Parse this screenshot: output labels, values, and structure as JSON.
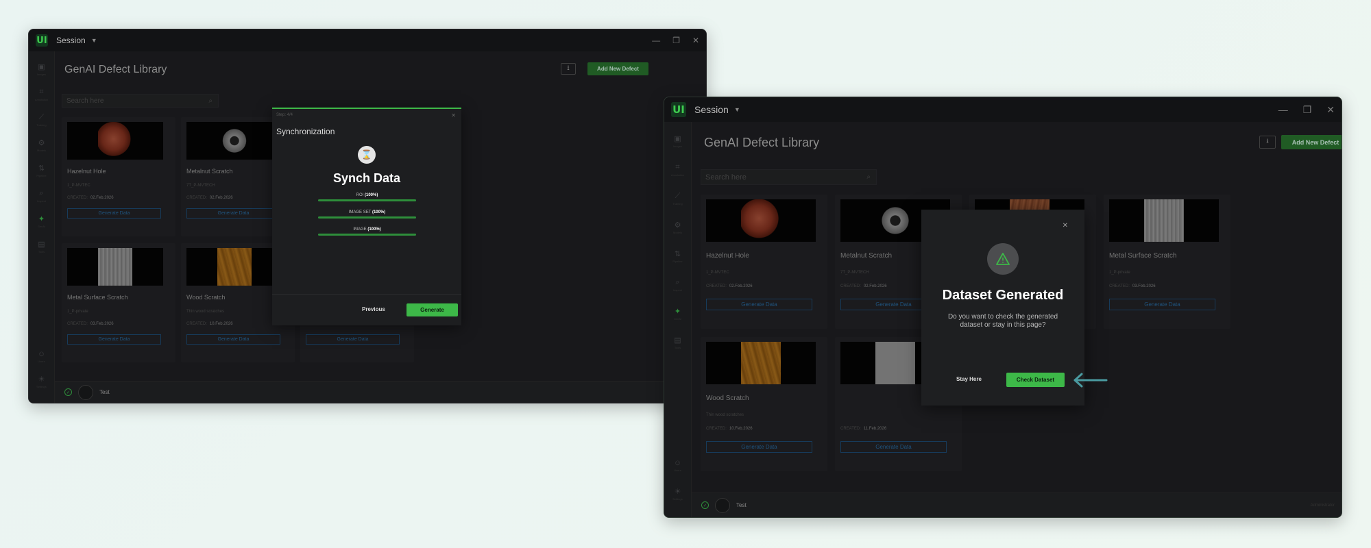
{
  "window": {
    "session_label": "Session",
    "logo_text": "UI"
  },
  "rail": {
    "items": [
      {
        "label": "Images",
        "icon": "image-icon"
      },
      {
        "label": "Annotation",
        "icon": "crop-icon"
      },
      {
        "label": "Training",
        "icon": "chart-icon"
      },
      {
        "label": "Models",
        "icon": "gear-icon"
      },
      {
        "label": "Pipeline",
        "icon": "pipeline-icon"
      },
      {
        "label": "Inspect",
        "icon": "zoom-icon"
      },
      {
        "label": "GenAI",
        "icon": "magic-wand-icon",
        "active": true
      },
      {
        "label": "Tools",
        "icon": "clipboard-icon"
      }
    ],
    "bottom": [
      {
        "label": "Users",
        "icon": "user-icon"
      },
      {
        "label": "Settings",
        "icon": "bulb-icon"
      }
    ]
  },
  "library": {
    "title": "GenAI Defect Library",
    "add_button": "Add New Defect",
    "search_placeholder": "Search here",
    "created_label": "CREATED:",
    "generate_label": "Generate Data",
    "cards": [
      {
        "name": "Hazelnut Hole",
        "sub": "1_P-MVTEC",
        "date": "02.Feb.2026",
        "texture": "orange"
      },
      {
        "name": "Metalnut Scratch",
        "sub": "7T_P-MVTECH",
        "date": "02.Feb.2026",
        "texture": "gear"
      },
      {
        "name": "Wood Scratch",
        "sub": "1_P-MVTEC",
        "date": "02.Feb.2026",
        "texture": "wood"
      },
      {
        "name": "Metal Surface Scratch",
        "sub": "1_P-private",
        "date": "03.Feb.2026",
        "texture": "metal"
      },
      {
        "name": "Wood Scratch",
        "sub": "Thin wood scratches",
        "date": "10.Feb.2026",
        "texture": "wood2"
      },
      {
        "name": "",
        "sub": "",
        "date": "11.Feb.2026",
        "texture": "gray"
      }
    ]
  },
  "footer": {
    "user": "Test",
    "role": "Administrator"
  },
  "sync_modal": {
    "step": "Step: 4/4",
    "title": "Synchronization",
    "heading": "Synch Data",
    "progress": [
      {
        "label": "ROI",
        "value": "(100%)",
        "fraction": 1.0
      },
      {
        "label": "IMAGE SET",
        "value": "(100%)",
        "fraction": 1.0
      },
      {
        "label": "IMAGE",
        "value": "(100%)",
        "fraction": 1.0
      }
    ],
    "previous": "Previous",
    "generate": "Generate"
  },
  "dataset_modal": {
    "heading": "Dataset Generated",
    "message": "Do you want to check the generated dataset or stay in this page?",
    "stay": "Stay Here",
    "check": "Check Dataset"
  },
  "colors": {
    "accent_green": "#3db848",
    "teal_arrow": "#4a9aa0",
    "link_blue": "#2a6fa8"
  }
}
